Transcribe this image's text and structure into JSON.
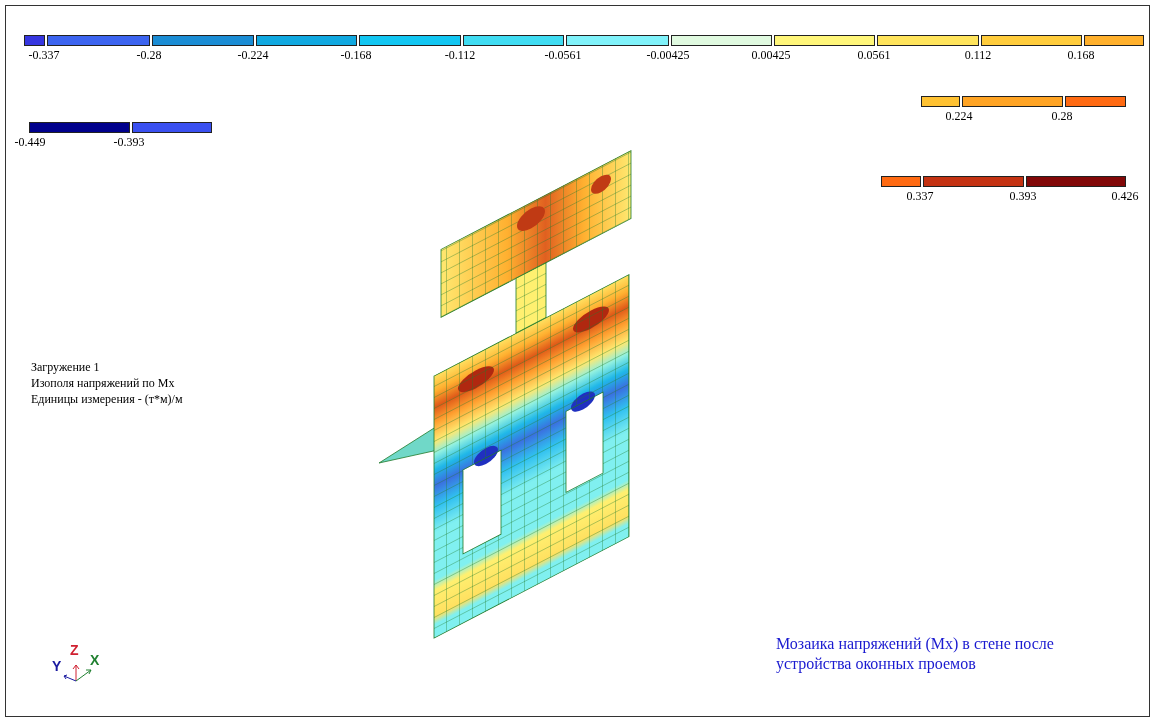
{
  "legends": [
    {
      "segments": [
        {
          "color": "#3636e0",
          "label": "-0.337"
        },
        {
          "color": "#3c64f0",
          "label": "-0.28"
        },
        {
          "color": "#1a8cd4",
          "label": "-0.224"
        },
        {
          "color": "#10a8e0",
          "label": "-0.168"
        },
        {
          "color": "#12c6f2",
          "label": "-0.112"
        },
        {
          "color": "#40dcf2",
          "label": "-0.0561"
        },
        {
          "color": "#80f2fa",
          "label": "-0.00425"
        },
        {
          "color": "#e0fae0",
          "label": "0.00425"
        },
        {
          "color": "#fff67a",
          "label": "0.0561"
        },
        {
          "color": "#ffe45c",
          "label": "0.112"
        },
        {
          "color": "#ffcc3c",
          "label": "0.168"
        },
        {
          "color": "#ffb02c"
        }
      ]
    },
    {
      "segments": [
        {
          "color": "#ffc232",
          "label": "0.224"
        },
        {
          "color": "#ffa424",
          "label": "0.28"
        },
        {
          "color": "#ff6a12"
        }
      ]
    },
    {
      "start_label": "-0.449",
      "segments": [
        {
          "color": "#00008c",
          "label": "-0.393"
        },
        {
          "color": "#3a50f0"
        }
      ]
    },
    {
      "segments": [
        {
          "color": "#ff6a12",
          "label": "0.337"
        },
        {
          "color": "#c43212",
          "label": "0.393"
        },
        {
          "color": "#820808",
          "label": "0.426"
        }
      ]
    }
  ],
  "info_lines": [
    "Загружение 1",
    "Изополя напряжений по Mx",
    "Единицы измерения - (т*м)/м"
  ],
  "axes": {
    "z": "Z",
    "y": "Y",
    "x": "X"
  },
  "caption": "Мозаика напряжений (Mx) в стене после устройства оконных проемов"
}
